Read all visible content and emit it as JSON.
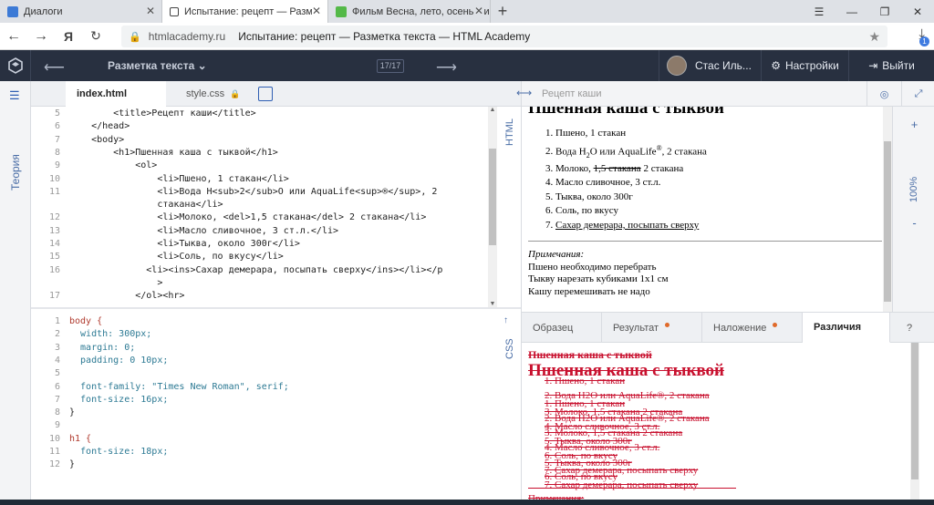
{
  "browser": {
    "tabs": [
      {
        "title": "Диалоги",
        "color": "#3c7ad6"
      },
      {
        "title": "Испытание: рецепт — Разме",
        "color": "#444444"
      },
      {
        "title": "Фильм Весна, лето, осень, зи",
        "color": "#54b948"
      }
    ],
    "nav": {
      "back": "←",
      "forward": "→",
      "yandex": "Я",
      "refresh": "C"
    },
    "url_host": "htmlacademy.ru",
    "url_title": "Испытание: рецепт — Разметка текста — HTML Academy",
    "download_badge": "1"
  },
  "academy": {
    "lesson": "Разметка текста",
    "counter": "17/17",
    "user": "Стас Иль...",
    "settings": "Настройки",
    "logout": "Выйти",
    "theory": "Теория"
  },
  "editor": {
    "tab_html": "index.html",
    "tab_css": "style.css",
    "html_label": "HTML",
    "css_label": "CSS",
    "html_lines": [
      {
        "n": "5",
        "t": "        <title>Рецепт каши</title>"
      },
      {
        "n": "6",
        "t": "    </head>"
      },
      {
        "n": "7",
        "t": "    <body>"
      },
      {
        "n": "8",
        "t": "        <h1>Пшенная каша с тыквой</h1>"
      },
      {
        "n": "9",
        "t": "            <ol>"
      },
      {
        "n": "10",
        "t": "                <li>Пшено, 1 стакан</li>"
      },
      {
        "n": "11",
        "t": "                <li>Вода H<sub>2</sub>O или AquaLife<sup>®</sup>, 2"
      },
      {
        "n": "",
        "t": "                стакана</li>"
      },
      {
        "n": "12",
        "t": "                <li>Молоко, <del>1,5 стакана</del> 2 стакана</li>"
      },
      {
        "n": "13",
        "t": "                <li>Масло сливочное, 3 ст.л.</li>"
      },
      {
        "n": "14",
        "t": "                <li>Тыква, около 300г</li>"
      },
      {
        "n": "15",
        "t": "                <li>Соль, по вкусу</li>"
      },
      {
        "n": "16",
        "t": "              <li><ins>Сахар демерара, посыпать сверху</ins></li></p"
      },
      {
        "n": "",
        "t": "                >"
      },
      {
        "n": "17",
        "t": "            </ol><hr>"
      }
    ],
    "css_lines": [
      {
        "n": "1",
        "t": "body {",
        "c": "kw"
      },
      {
        "n": "2",
        "t": "  width: 300px;",
        "c": "pr"
      },
      {
        "n": "3",
        "t": "  margin: 0;",
        "c": "pr"
      },
      {
        "n": "4",
        "t": "  padding: 0 10px;",
        "c": "pr"
      },
      {
        "n": "5",
        "t": "",
        "c": "va"
      },
      {
        "n": "6",
        "t": "  font-family: \"Times New Roman\", serif;",
        "c": "pr"
      },
      {
        "n": "7",
        "t": "  font-size: 16px;",
        "c": "pr"
      },
      {
        "n": "8",
        "t": "}",
        "c": "va"
      },
      {
        "n": "9",
        "t": "",
        "c": "va"
      },
      {
        "n": "10",
        "t": "h1 {",
        "c": "kw"
      },
      {
        "n": "11",
        "t": "  font-size: 18px;",
        "c": "pr"
      },
      {
        "n": "12",
        "t": "}",
        "c": "va"
      }
    ]
  },
  "preview": {
    "url": "Рецепт каши",
    "zoom": "100%",
    "zoom_plus": "+",
    "zoom_minus": "-",
    "h1": "Пшенная каша с тыквой",
    "items": [
      "Пшено, 1 стакан",
      "Вода H2O или AquaLife®, 2 стакана",
      "Молоко, 1,5 стакана 2 стакана",
      "Масло сливочное, 3 ст.л.",
      "Тыква, около 300г",
      "Соль, по вкусу",
      "Сахар демерара, посыпать сверху"
    ],
    "notes_title": "Примечания:",
    "notes": [
      "Пшено необходимо перебрать",
      "Тыкву нарезать кубиками 1x1 см",
      "Кашу перемешивать не надо"
    ],
    "tabs": [
      "Образец",
      "Результат",
      "Наложение",
      "Различия",
      "?"
    ]
  },
  "diff": {
    "lines": [
      {
        "t": "Пшенная каша с тыквой",
        "size": 12
      },
      {
        "t": "Пшенная каша с тыквой",
        "size": 19
      },
      {
        "t": "1. Пшено, 1 стакан",
        "size": 11
      },
      {
        "t": "2. Вода H2O или AquaLife®, 2 стакана",
        "size": 11
      },
      {
        "t": "1. Пшено, 1 стакан",
        "size": 11
      },
      {
        "t": "3. Молоко, 1,5 стакана 2 стакана",
        "size": 11
      },
      {
        "t": "2. Вода H2O или AquaLife®, 2 стакана",
        "size": 11
      },
      {
        "t": "4. Масло сливочное, 3 ст.л.",
        "size": 11
      },
      {
        "t": "3. Молоко, 1,5 стакана 2 стакана",
        "size": 11
      },
      {
        "t": "5. Тыква, около 300г",
        "size": 11
      },
      {
        "t": "4. Масло сливочное, 3 ст.л.",
        "size": 11
      },
      {
        "t": "6. Соль, по вкусу",
        "size": 11
      },
      {
        "t": "5. Тыква, около 300г",
        "size": 11
      },
      {
        "t": "7. Сахар демерара, посыпать сверху",
        "size": 11
      },
      {
        "t": "6. Соль, по вкусу",
        "size": 11
      },
      {
        "t": "7. Сахар демерара, посыпать сверху",
        "size": 11
      },
      {
        "t": "Примечания:",
        "size": 11
      }
    ]
  }
}
